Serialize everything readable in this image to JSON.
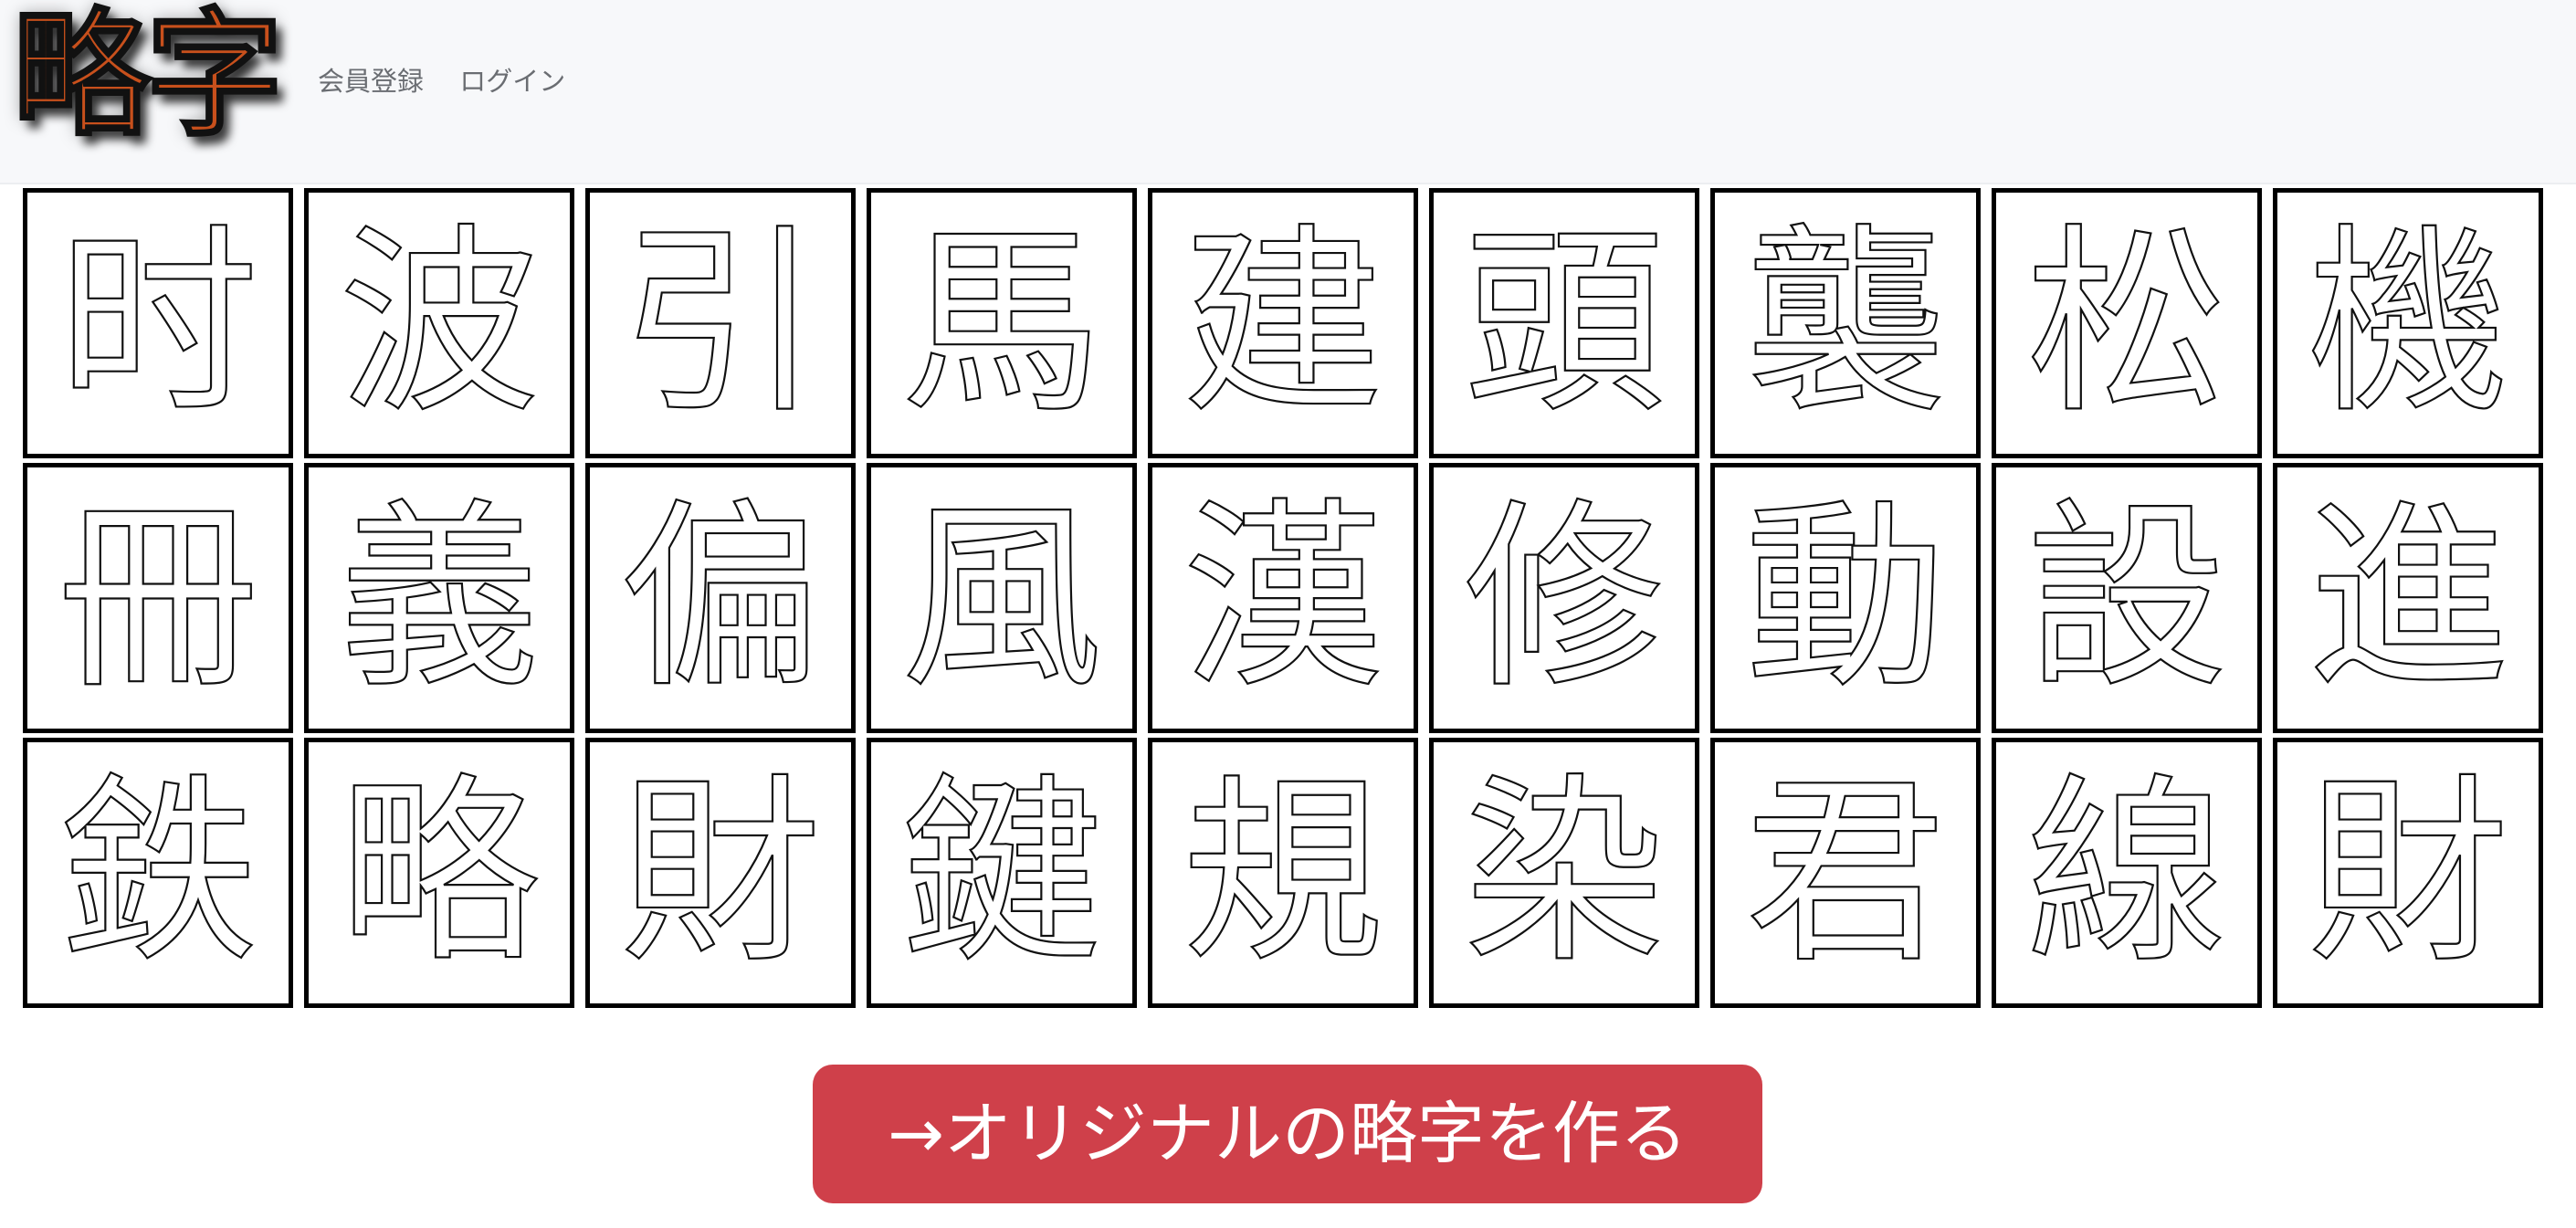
{
  "header": {
    "logo": "略字",
    "links": [
      "会員登録",
      "ログイン"
    ]
  },
  "grid": {
    "cells": [
      "时",
      "波",
      "引",
      "馬",
      "建",
      "頭",
      "襲",
      "松",
      "機",
      "冊",
      "義",
      "偏",
      "風",
      "漢",
      "修",
      "動",
      "設",
      "進",
      "鉄",
      "略",
      "財",
      "鍵",
      "規",
      "染",
      "君",
      "線",
      "財"
    ]
  },
  "cta": {
    "label": "→オリジナルの略字を作る"
  },
  "colors": {
    "accent": "#cf404a",
    "logo": "#c8501c",
    "navbar": "#f7f8fa"
  }
}
